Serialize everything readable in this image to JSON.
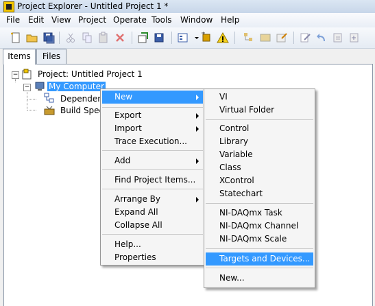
{
  "window": {
    "title": "Project Explorer - Untitled Project 1 *"
  },
  "menubar": [
    "File",
    "Edit",
    "View",
    "Project",
    "Operate",
    "Tools",
    "Window",
    "Help"
  ],
  "tabs": [
    "Items",
    "Files"
  ],
  "tree": {
    "project": "Project: Untitled Project 1",
    "computer": "My Computer",
    "dependencies": "Dependencies",
    "build_specs": "Build Specifications"
  },
  "context_menu": {
    "new": "New",
    "export": "Export",
    "import": "Import",
    "trace": "Trace Execution...",
    "add": "Add",
    "find": "Find Project Items...",
    "arrange": "Arrange By",
    "expand": "Expand All",
    "collapse": "Collapse All",
    "help": "Help...",
    "properties": "Properties"
  },
  "submenu": {
    "vi": "VI",
    "virtual_folder": "Virtual Folder",
    "control": "Control",
    "library": "Library",
    "variable": "Variable",
    "class": "Class",
    "xcontrol": "XControl",
    "statechart": "Statechart",
    "daqmx_task": "NI-DAQmx Task",
    "daqmx_channel": "NI-DAQmx Channel",
    "daqmx_scale": "NI-DAQmx Scale",
    "targets": "Targets and Devices...",
    "new_dots": "New..."
  },
  "colors": {
    "selection": "#3399ff",
    "titlebar": "#c7d6e9"
  }
}
